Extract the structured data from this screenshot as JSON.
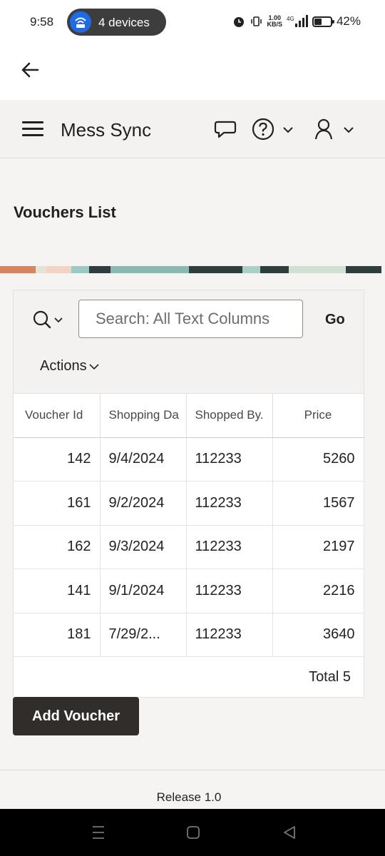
{
  "status_bar": {
    "time": "9:58",
    "hotspot_label": "4 devices",
    "net_speed_value": "1.00",
    "net_speed_unit": "KB/S",
    "battery": "42%"
  },
  "header": {
    "app_title": "Mess Sync"
  },
  "page": {
    "title": "Vouchers List"
  },
  "toolbar": {
    "search_placeholder": "Search: All Text Columns",
    "go_label": "Go",
    "actions_label": "Actions"
  },
  "table": {
    "columns": [
      "Voucher Id",
      "Shopping Da",
      "Shopped By.",
      "Price"
    ],
    "rows": [
      [
        "142",
        "9/4/2024",
        "112233",
        "5260"
      ],
      [
        "161",
        "9/2/2024",
        "112233",
        "1567"
      ],
      [
        "162",
        "9/3/2024",
        "112233",
        "2197"
      ],
      [
        "141",
        "9/1/2024",
        "112233",
        "2216"
      ],
      [
        "181",
        "7/29/2...",
        "112233",
        "3640"
      ]
    ],
    "total": "Total 5"
  },
  "add_button": "Add Voucher",
  "footer": {
    "release": "Release 1.0"
  },
  "colors": {
    "accent": "#1e6be6",
    "button_dark": "#312d2a",
    "header_bg": "#f3f2f0"
  }
}
